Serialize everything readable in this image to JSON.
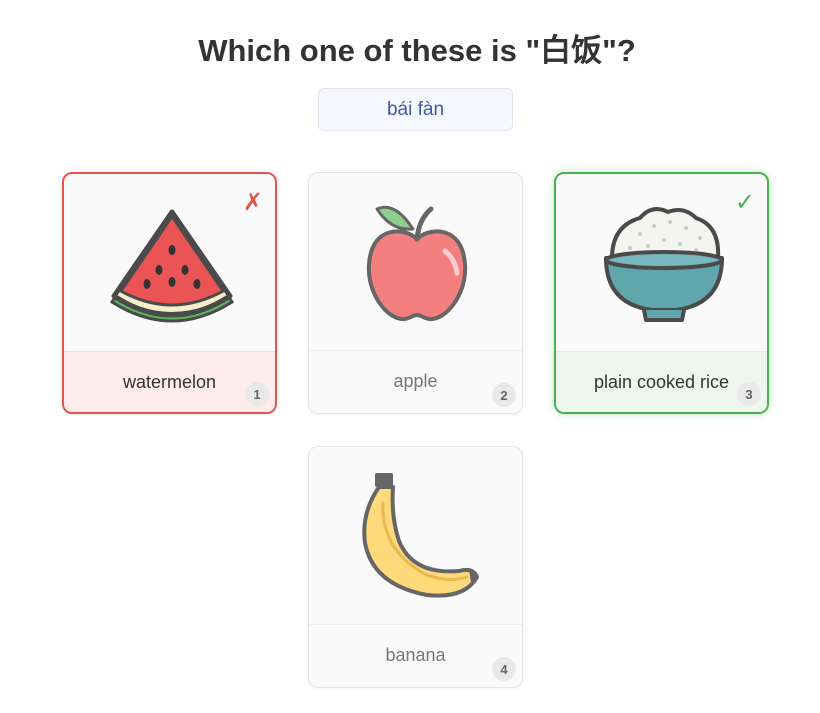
{
  "question": {
    "prompt": "Which one of these is \"白饭\"?",
    "pinyin": "bái fàn"
  },
  "options": [
    {
      "label": "watermelon",
      "number": "1",
      "state": "wrong",
      "mark": "✗",
      "icon": "watermelon-icon"
    },
    {
      "label": "apple",
      "number": "2",
      "state": "neutral",
      "icon": "apple-icon"
    },
    {
      "label": "plain cooked rice",
      "number": "3",
      "state": "correct",
      "mark": "✓",
      "icon": "rice-bowl-icon"
    },
    {
      "label": "banana",
      "number": "4",
      "state": "neutral",
      "icon": "banana-icon"
    }
  ],
  "colors": {
    "wrong": "#e4544a",
    "correct": "#4caf50",
    "pinyin": "#3d5aa6"
  }
}
